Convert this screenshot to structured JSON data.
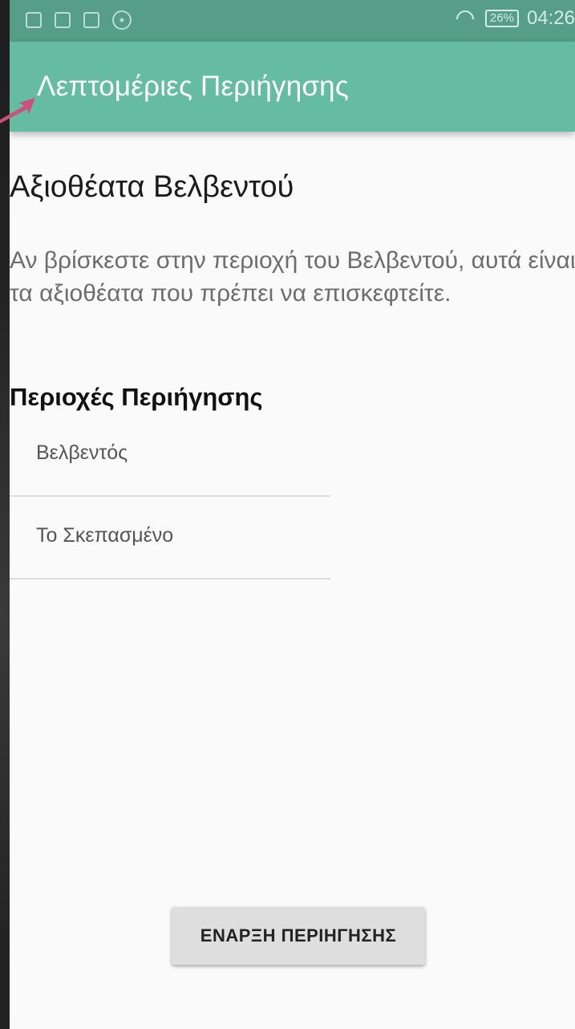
{
  "status_bar": {
    "battery": "26%",
    "time": "04:26",
    "icons": [
      "notification-icon",
      "gallery-icon",
      "map-icon",
      "compass-icon",
      "wifi-icon",
      "battery-icon"
    ]
  },
  "toolbar": {
    "title": "Λεπτομέριες Περιήγησης"
  },
  "content": {
    "heading": "Αξιοθέατα Βελβεντού",
    "description": "Αν βρίσκεστε στην περιοχή του Βελβεντού, αυτά είναι τα αξιοθέατα που πρέπει να επισκεφτείτε.",
    "section_title": "Περιοχές Περιήγησης",
    "areas": [
      {
        "label": "Βελβεντός"
      },
      {
        "label": "Το Σκεπασμένο"
      }
    ]
  },
  "actions": {
    "start_label": "ΕΝΑΡΞΗ ΠΕΡΙΗΓΗΣΗΣ"
  },
  "colors": {
    "status_bar": "#569e88",
    "toolbar": "#66bba3",
    "background": "#fafafa",
    "button": "#dedede",
    "pointer": "#c9527a"
  }
}
